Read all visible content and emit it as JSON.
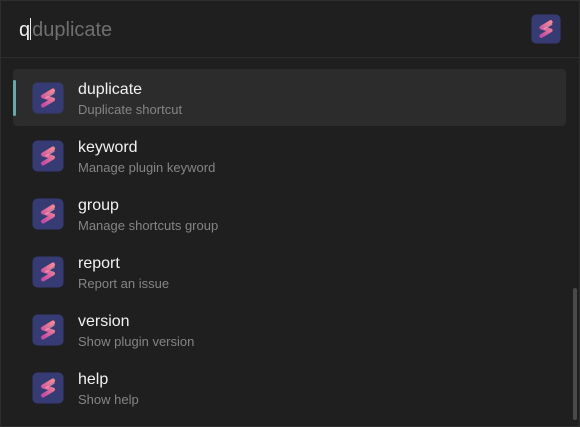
{
  "search": {
    "typed": "q",
    "suggestion": "duplicate"
  },
  "results": [
    {
      "title": "duplicate",
      "subtitle": "Duplicate shortcut"
    },
    {
      "title": "keyword",
      "subtitle": "Manage plugin keyword"
    },
    {
      "title": "group",
      "subtitle": "Manage shortcuts group"
    },
    {
      "title": "report",
      "subtitle": "Report an issue"
    },
    {
      "title": "version",
      "subtitle": "Show plugin version"
    },
    {
      "title": "help",
      "subtitle": "Show help"
    }
  ],
  "selected_index": 0,
  "icons": {
    "app": "shortcuts-plugin-icon",
    "result": "shortcuts-plugin-icon"
  },
  "colors": {
    "background": "#1f1f1f",
    "selected_row": "#2c2c2c",
    "selection_accent": "#6aa8a8",
    "icon_bg": "#3a3f78",
    "icon_stroke_start": "#c85aa8",
    "icon_stroke_end": "#f07a8e"
  }
}
